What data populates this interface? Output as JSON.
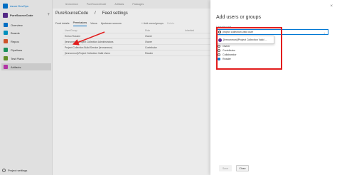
{
  "brand": {
    "name": "Azure DevOps"
  },
  "project": {
    "name": "PureSourceCode",
    "add": "+"
  },
  "nav": {
    "items": [
      {
        "label": "Overview",
        "color": "#0078d4"
      },
      {
        "label": "Boards",
        "color": "#009ccc"
      },
      {
        "label": "Repos",
        "color": "#e05b2d"
      },
      {
        "label": "Pipelines",
        "color": "#1e9e64"
      },
      {
        "label": "Test Plans",
        "color": "#6b9c2b"
      },
      {
        "label": "Artifacts",
        "color": "#c239b3"
      }
    ],
    "active_index": 5,
    "footer": "Project settings"
  },
  "topbar": {
    "items": [
      "lennonmon",
      "PureSourceCode",
      "Artifacts",
      "Packages"
    ]
  },
  "main": {
    "crumb_project": "PureSourceCode",
    "crumb_sep": "/",
    "crumb_page": "Feed settings",
    "tabs": [
      "Feed details",
      "Permissions",
      "Views",
      "Upstream sources"
    ],
    "active_tab": 1,
    "add_button": "+ Add users/groups",
    "delete_button": "Delete",
    "columns": [
      "User/Group",
      "Role",
      "Inherited"
    ],
    "rows": [
      {
        "user": "Enrico Rossini",
        "role": "Owner",
        "inherited": ""
      },
      {
        "user": "[lennonmon]\\Project Collection Administrators",
        "role": "Owner",
        "inherited": ""
      },
      {
        "user": "Project Collection Build Service (lennonmon)",
        "role": "Contributor",
        "inherited": ""
      },
      {
        "user": "[lennonmon]\\Project Collection Valid Users",
        "role": "Reader",
        "inherited": ""
      }
    ]
  },
  "panel": {
    "title": "Add users or groups",
    "close_icon": "×",
    "field_label": "Users/groups",
    "field_value": "project collection valid user",
    "suggestion": "[lennonmon]\\Project Collection Valid ...",
    "roles": [
      "Owner",
      "Contributor",
      "Collaborator",
      "Reader"
    ],
    "selected_role": "Reader",
    "save": "Save",
    "close": "Close"
  },
  "colors": {
    "accent": "#0078d4",
    "annotation": "#e21d1d"
  }
}
